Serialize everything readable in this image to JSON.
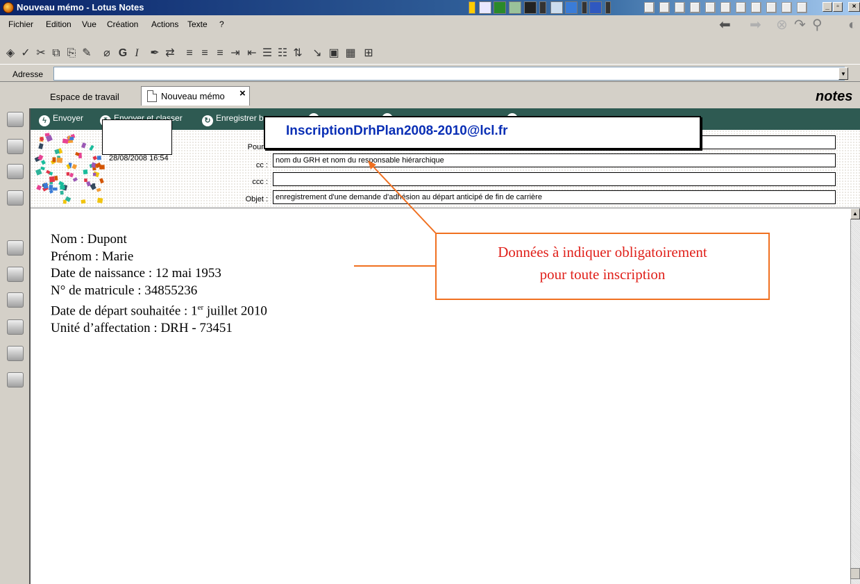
{
  "window": {
    "title": "Nouveau mémo - Lotus Notes"
  },
  "menu": [
    "Fichier",
    "Edition",
    "Vue",
    "Création",
    "Actions",
    "Texte",
    "?"
  ],
  "address": {
    "label": "Adresse",
    "value": ""
  },
  "tabs": {
    "workspace": "Espace de travail",
    "memo": "Nouveau mémo",
    "close_glyph": "×"
  },
  "brand": "notes",
  "actions": {
    "send": "Envoyer",
    "send_file": "Envoyer et classer",
    "save": "Enregistrer b"
  },
  "header": {
    "date": "28/08/2008 16:54",
    "to_label": "Pour :",
    "cc_label": "cc :",
    "bcc_label": "ccc :",
    "subject_label": "Objet :",
    "to_value": "",
    "cc_value": "nom du GRH et nom du responsable hiérarchique",
    "bcc_value": "",
    "subject_value": "enregistrement d'une demande d'adhésion au départ anticipé de fin de carrière"
  },
  "to_overlay": "InscriptionDrhPlan2008-2010@lcl.fr",
  "body": {
    "nom": "Nom : Dupont",
    "prenom": "Prénom : Marie",
    "naissance": "Date de naissance : 12 mai 1953",
    "matricule": "N° de matricule : 34855236",
    "depart_pre": "Date de départ souhaitée : 1",
    "depart_sup": "er",
    "depart_post": " juillet 2010",
    "unite": "Unité d’affectation : DRH - 73451"
  },
  "annotation": {
    "line1": "Données à indiquer obligatoirement",
    "line2": "pour toute inscription",
    "color": "#e0201a",
    "border_color": "#f07020"
  },
  "colors": {
    "action_bar": "#2e5a52",
    "email_link": "#0a2fb5"
  }
}
